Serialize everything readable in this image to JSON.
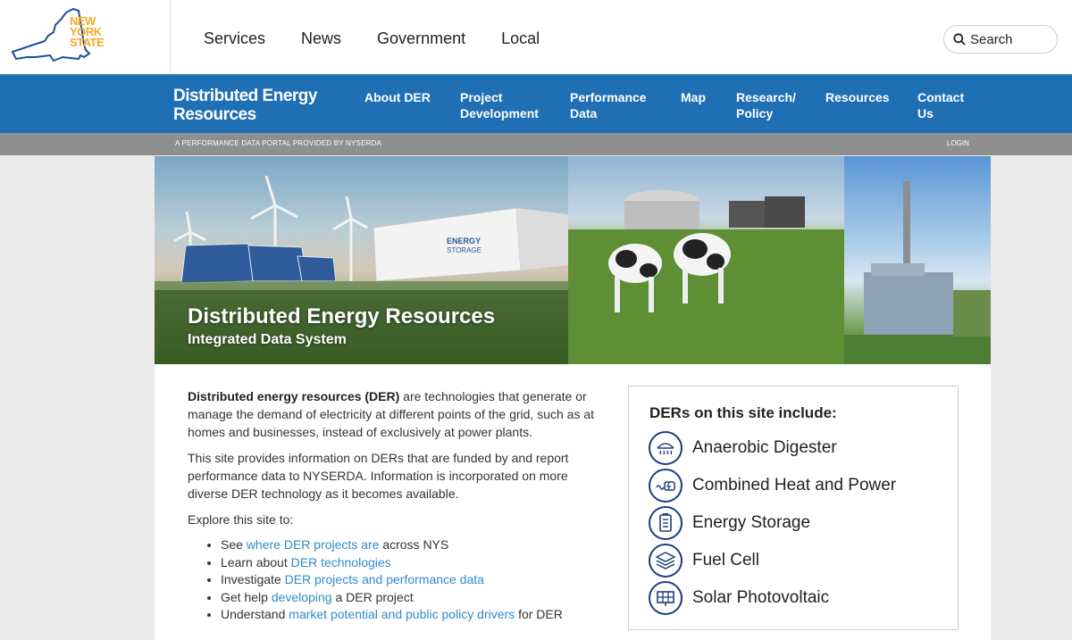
{
  "nys": {
    "logo_line1": "NEW",
    "logo_line2": "YORK",
    "logo_line3": "STATE",
    "nav": [
      "Services",
      "News",
      "Government",
      "Local"
    ],
    "search_label": "Search"
  },
  "der_header": {
    "brand_line1": "Distributed Energy",
    "brand_line2": "Resources",
    "nav": [
      {
        "line1": "About DER",
        "line2": ""
      },
      {
        "line1": "Project",
        "line2": "Development"
      },
      {
        "line1": "Performance",
        "line2": "Data"
      },
      {
        "line1": "Map",
        "line2": ""
      },
      {
        "line1": "Research/",
        "line2": "Policy"
      },
      {
        "line1": "Resources",
        "line2": ""
      },
      {
        "line1": "Contact",
        "line2": "Us"
      }
    ]
  },
  "sub_bar": {
    "tagline": "A PERFORMANCE DATA PORTAL PROVIDED BY NYSERDA",
    "login": "LOGIN"
  },
  "hero": {
    "title": "Distributed Energy Resources",
    "subtitle": "Integrated Data System",
    "storage_label_1": "ENERGY",
    "storage_label_2": "STORAGE"
  },
  "intro": {
    "p1_bold": "Distributed energy resources (DER)",
    "p1_rest": " are technologies that generate or manage the demand of electricity at different points of the grid, such as at homes and businesses, instead of exclusively at power plants.",
    "p2": "This site provides information on DERs that are funded by and report performance data to NYSERDA. Information is incorporated on more diverse DER technology as it becomes available.",
    "p3": "Explore this site to:",
    "list": [
      {
        "pre": "See ",
        "link": "where DER projects are",
        "post": " across NYS"
      },
      {
        "pre": "Learn about ",
        "link": "DER technologies",
        "post": ""
      },
      {
        "pre": "Investigate ",
        "link": "DER projects and performance data",
        "post": ""
      },
      {
        "pre": "Get help ",
        "link": "developing",
        "post": " a DER project"
      },
      {
        "pre": "Understand ",
        "link": "market potential and public policy drivers",
        "post": " for DER"
      }
    ]
  },
  "der_box": {
    "title": "DERs on this site include:",
    "items": [
      {
        "label": "Anaerobic Digester",
        "icon": "anaerobic-digester-icon"
      },
      {
        "label": "Combined Heat and Power",
        "icon": "combined-heat-power-icon"
      },
      {
        "label": "Energy Storage",
        "icon": "energy-storage-icon"
      },
      {
        "label": "Fuel Cell",
        "icon": "fuel-cell-icon"
      },
      {
        "label": "Solar Photovoltaic",
        "icon": "solar-photovoltaic-icon"
      }
    ]
  },
  "colors": {
    "nys_orange": "#f7a823",
    "der_blue": "#1f6fb5",
    "sub_gray": "#8f8f8f",
    "link_blue": "#2f8bc9",
    "icon_navy": "#1d3f7a"
  }
}
